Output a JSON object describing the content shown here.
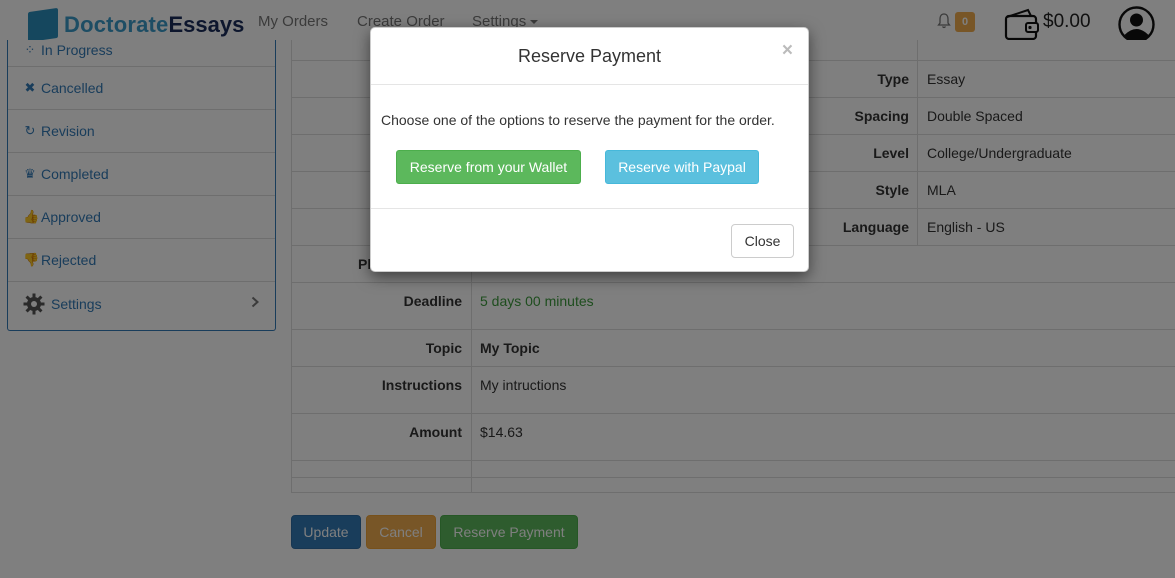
{
  "brand": {
    "part1": "Doctorate",
    "part2": "Essays"
  },
  "nav": {
    "my_orders": "My Orders",
    "create_order": "Create Order",
    "settings": "Settings"
  },
  "header": {
    "notification_count": "0",
    "wallet_balance": "$0.00"
  },
  "sidebar": {
    "items": [
      {
        "label": "In Progress",
        "icon": "spinner-icon"
      },
      {
        "label": "Cancelled",
        "icon": "times-icon"
      },
      {
        "label": "Revision",
        "icon": "refresh-icon"
      },
      {
        "label": "Completed",
        "icon": "trophy-icon"
      },
      {
        "label": "Approved",
        "icon": "thumbs-up-icon"
      },
      {
        "label": "Rejected",
        "icon": "thumbs-down-icon"
      },
      {
        "label": "Settings",
        "icon": "gear-icon"
      }
    ]
  },
  "details": {
    "rows": [
      {
        "label": "Type",
        "value": "Essay"
      },
      {
        "label": "Spacing",
        "value": "Double Spaced"
      },
      {
        "label": "Level",
        "value": "College/Undergraduate"
      },
      {
        "label": "Style",
        "value": "MLA"
      },
      {
        "label": "Language",
        "value": "English - US"
      }
    ],
    "deadline_label": "Deadline",
    "deadline_value": "5 days 00 minutes",
    "topic_label": "Topic",
    "topic_value": "My Topic",
    "instructions_label": "Instructions",
    "instructions_value": "My intructions",
    "amount_label": "Amount",
    "amount_value": "$14.63",
    "partial_label": "Pl"
  },
  "actions": {
    "update": "Update",
    "cancel": "Cancel",
    "reserve": "Reserve Payment"
  },
  "modal": {
    "title": "Reserve Payment",
    "close_x": "×",
    "text": "Choose one of the options to reserve the payment for the order.",
    "wallet_button": "Reserve from your Wallet",
    "paypal_button": "Reserve with Paypal",
    "close_button": "Close"
  },
  "colors": {
    "primary": "#337ab7",
    "success": "#5cb85c",
    "warning": "#f0ad4e",
    "info": "#5bc0de",
    "deadline": "#3c9a3c"
  }
}
